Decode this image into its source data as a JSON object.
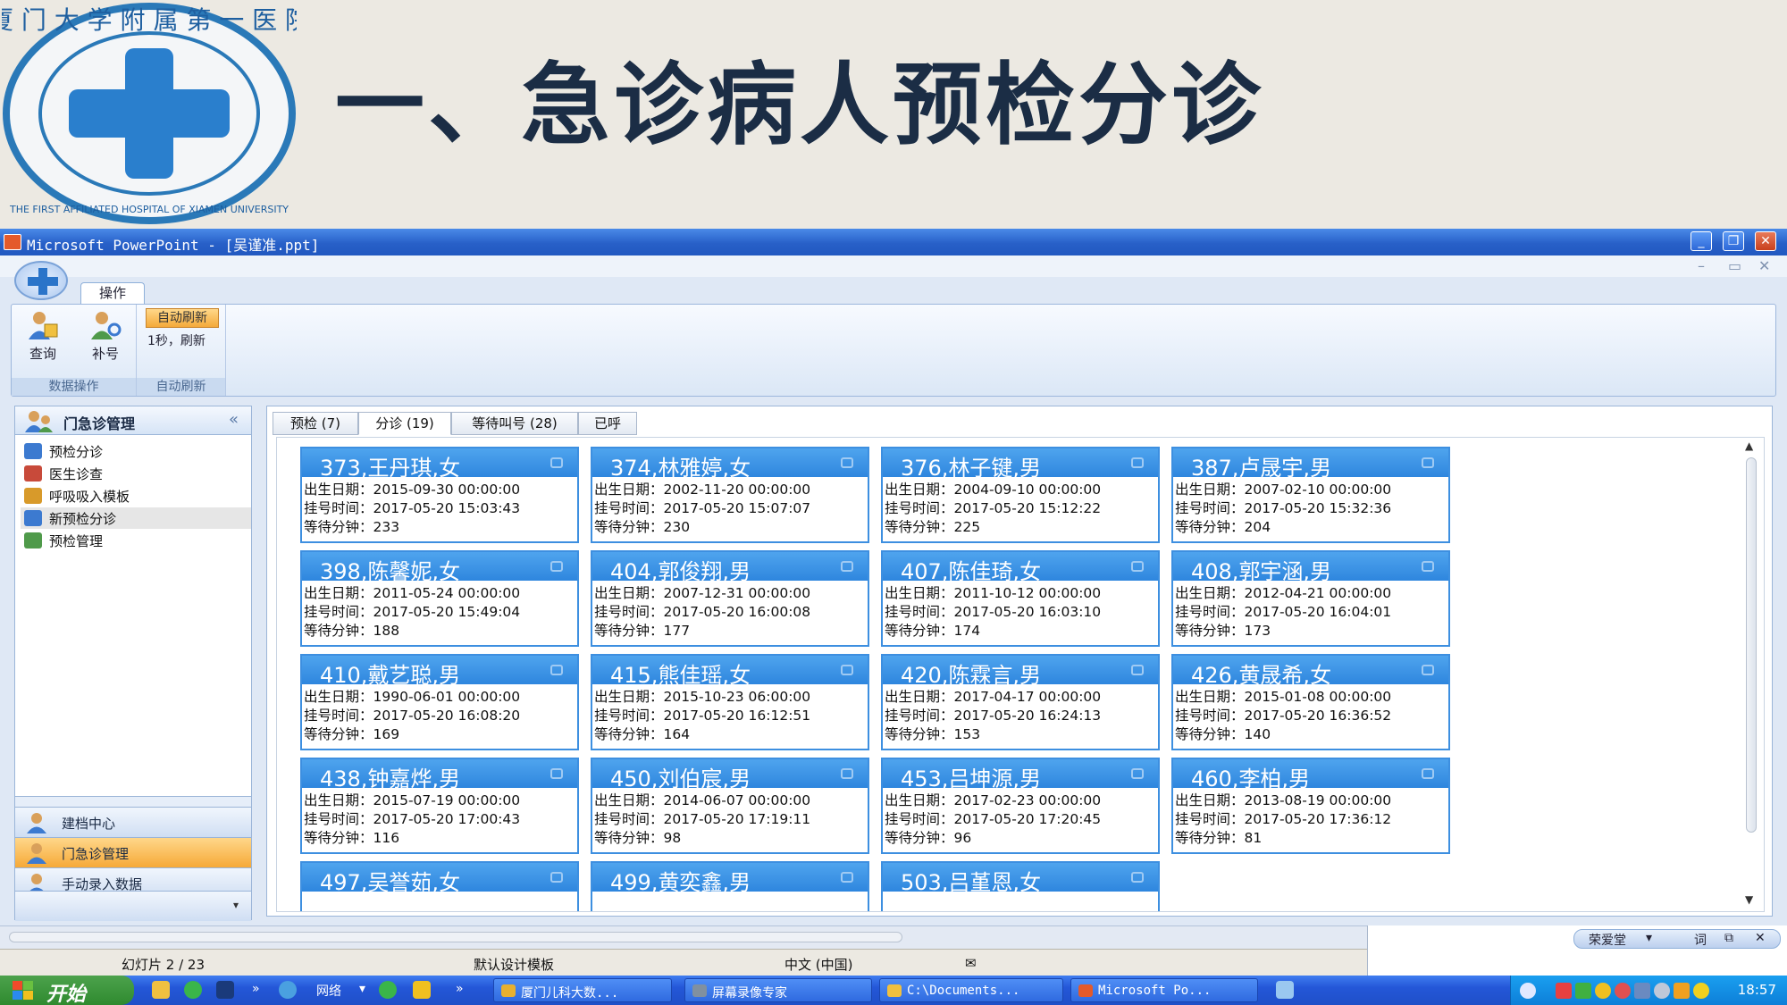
{
  "slide": {
    "title": "一、急诊病人预检分诊",
    "logo_text_cn": "厦门大学附属第一医院",
    "logo_text_en": "THE FIRST AFFILIATED HOSPITAL OF XIAMEN UNIVERSITY"
  },
  "window": {
    "title": "Microsoft PowerPoint - [吴谨准.ppt]",
    "buttons": [
      "minimize",
      "restore",
      "close"
    ]
  },
  "ribbon": {
    "tab": "操作",
    "query_label": "查询",
    "renumber_label": "补号",
    "group1_label": "数据操作",
    "auto_refresh_badge": "自动刷新",
    "auto_refresh_text": "1秒，刷新",
    "group2_label": "自动刷新"
  },
  "sidebar": {
    "header": "门急诊管理",
    "collapse_glyph": "«",
    "items": [
      {
        "label": "预检分诊",
        "icon": "person-icon"
      },
      {
        "label": "医生诊查",
        "icon": "doctor-icon"
      },
      {
        "label": "呼吸吸入模板",
        "icon": "template-icon"
      },
      {
        "label": "新预检分诊",
        "icon": "person-icon",
        "selected": true
      },
      {
        "label": "预检管理",
        "icon": "manage-icon"
      }
    ],
    "nav": [
      {
        "label": "建档中心"
      },
      {
        "label": "门急诊管理",
        "active": true
      },
      {
        "label": "手动录入数据"
      }
    ]
  },
  "tabs": [
    {
      "label": "预检 (7)"
    },
    {
      "label": "分诊 (19)",
      "active": true
    },
    {
      "label": "等待叫号 (28)"
    },
    {
      "label": "已呼"
    }
  ],
  "field_labels": {
    "birth": "出生日期：",
    "register": "挂号时间：",
    "wait": "等待分钟："
  },
  "patients": [
    {
      "title": "373,王丹琪,女",
      "birth": "2015-09-30 00:00:00",
      "register": "2017-05-20 15:03:43",
      "wait": "233"
    },
    {
      "title": "374,林雅婷,女",
      "birth": "2002-11-20 00:00:00",
      "register": "2017-05-20 15:07:07",
      "wait": "230"
    },
    {
      "title": "376,林子键,男",
      "birth": "2004-09-10 00:00:00",
      "register": "2017-05-20 15:12:22",
      "wait": "225"
    },
    {
      "title": "387,卢晟宇,男",
      "birth": "2007-02-10 00:00:00",
      "register": "2017-05-20 15:32:36",
      "wait": "204"
    },
    {
      "title": "398,陈馨妮,女",
      "birth": "2011-05-24 00:00:00",
      "register": "2017-05-20 15:49:04",
      "wait": "188"
    },
    {
      "title": "404,郭俊翔,男",
      "birth": "2007-12-31 00:00:00",
      "register": "2017-05-20 16:00:08",
      "wait": "177"
    },
    {
      "title": "407,陈佳琦,女",
      "birth": "2011-10-12 00:00:00",
      "register": "2017-05-20 16:03:10",
      "wait": "174"
    },
    {
      "title": "408,郭宇涵,男",
      "birth": "2012-04-21 00:00:00",
      "register": "2017-05-20 16:04:01",
      "wait": "173"
    },
    {
      "title": "410,戴艺聪,男",
      "birth": "1990-06-01 00:00:00",
      "register": "2017-05-20 16:08:20",
      "wait": "169"
    },
    {
      "title": "415,熊佳瑶,女",
      "birth": "2015-10-23 06:00:00",
      "register": "2017-05-20 16:12:51",
      "wait": "164"
    },
    {
      "title": "420,陈霖言,男",
      "birth": "2017-04-17 00:00:00",
      "register": "2017-05-20 16:24:13",
      "wait": "153"
    },
    {
      "title": "426,黄晟希,女",
      "birth": "2015-01-08 00:00:00",
      "register": "2017-05-20 16:36:52",
      "wait": "140"
    },
    {
      "title": "438,钟嘉烨,男",
      "birth": "2015-07-19 00:00:00",
      "register": "2017-05-20 17:00:43",
      "wait": "116"
    },
    {
      "title": "450,刘伯宸,男",
      "birth": "2014-06-07 00:00:00",
      "register": "2017-05-20 17:19:11",
      "wait": "98"
    },
    {
      "title": "453,吕坤源,男",
      "birth": "2017-02-23 00:00:00",
      "register": "2017-05-20 17:20:45",
      "wait": "96"
    },
    {
      "title": "460,李柏,男",
      "birth": "2013-08-19 00:00:00",
      "register": "2017-05-20 17:36:12",
      "wait": "81"
    },
    {
      "title": "497,吴誉茹,女"
    },
    {
      "title": "499,黄奕鑫,男"
    },
    {
      "title": "503,吕堇恩,女"
    }
  ],
  "statusbar": {
    "slide": "幻灯片 2 / 23",
    "template": "默认设计模板",
    "language": "中文 (中国)"
  },
  "langbar": {
    "ime": "荣爱堂",
    "word": "词"
  },
  "taskbar": {
    "start": "开始",
    "network": "网络",
    "windows": [
      {
        "label": "厦门儿科大数...",
        "icon": "chrome-icon"
      },
      {
        "label": "屏幕录像专家",
        "icon": "recorder-icon"
      },
      {
        "label": "C:\\Documents...",
        "icon": "folder-icon"
      },
      {
        "label": "Microsoft Po...",
        "icon": "powerpoint-icon"
      }
    ],
    "clock": "18:57"
  },
  "colors": {
    "card_header": "#2e86de",
    "title": "#1b2d45",
    "taskbar": "#2457d8",
    "active_nav": "#f6a937"
  }
}
